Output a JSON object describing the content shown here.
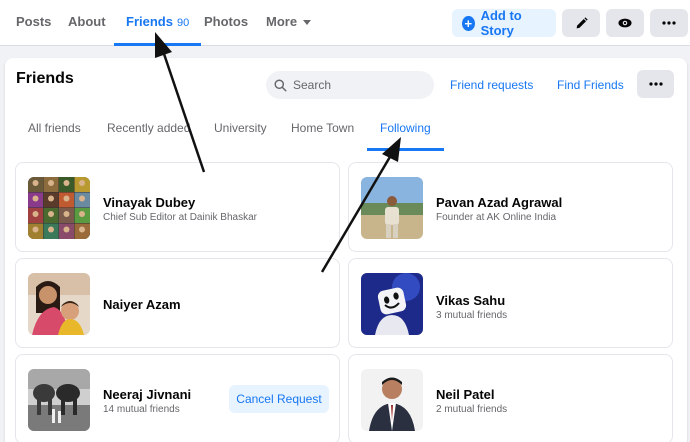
{
  "profile_tabs": [
    {
      "label": "Posts"
    },
    {
      "label": "About"
    },
    {
      "label": "Friends",
      "count": "90",
      "active": true
    },
    {
      "label": "Photos"
    },
    {
      "label": "More"
    }
  ],
  "header_actions": {
    "add_story": "Add to Story",
    "edit_icon": "pencil-icon",
    "view_icon": "eye-icon",
    "more_icon": "ellipsis-icon"
  },
  "friends_section": {
    "title": "Friends",
    "search_placeholder": "Search",
    "friend_requests": "Friend requests",
    "find_friends": "Find Friends",
    "tabs": [
      "All friends",
      "Recently added",
      "University",
      "Home Town",
      "Following"
    ],
    "active_tab": "Following"
  },
  "friends": [
    {
      "name": "Vinayak Dubey",
      "sub": "Chief Sub Editor at Dainik Bhaskar"
    },
    {
      "name": "Pavan Azad Agrawal",
      "sub": "Founder at AK Online India"
    },
    {
      "name": "Naiyer Azam",
      "sub": ""
    },
    {
      "name": "Vikas Sahu",
      "sub": "3 mutual friends"
    },
    {
      "name": "Neeraj Jivnani",
      "sub": "14 mutual friends",
      "action": "Cancel Request"
    },
    {
      "name": "Neil Patel",
      "sub": "2 mutual friends"
    }
  ],
  "colors": {
    "accent": "#1877f2",
    "accent_light": "#e7f3ff",
    "gray_button": "#e4e6eb"
  }
}
